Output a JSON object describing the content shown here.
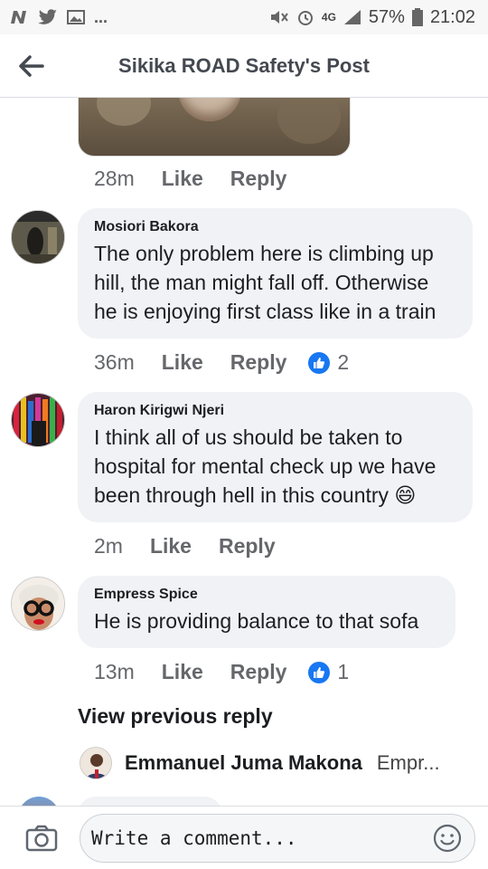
{
  "status_bar": {
    "left_icons": [
      "n-notification-icon",
      "twitter-icon",
      "image-icon"
    ],
    "more": "...",
    "network": "4G",
    "battery": "57%",
    "time": "21:02"
  },
  "header": {
    "title": "Sikika ROAD Safety's Post",
    "back_icon": "arrow-left-icon"
  },
  "comments": [
    {
      "time": "28m",
      "like_label": "Like",
      "reply_label": "Reply"
    },
    {
      "author": "Mosiori Bakora",
      "text": "The only problem here is climbing up hill, the man might fall off. Otherwise he is enjoying first class like in a train",
      "time": "36m",
      "like_label": "Like",
      "reply_label": "Reply",
      "reactions": "2"
    },
    {
      "author": "Haron Kirigwi Njeri",
      "text": "I think all of us should be taken to hospital for mental check up we have been through hell in this country 😄",
      "time": "2m",
      "like_label": "Like",
      "reply_label": "Reply"
    },
    {
      "author": "Empress Spice",
      "text": "He is providing balance to that sofa",
      "time": "13m",
      "like_label": "Like",
      "reply_label": "Reply",
      "reactions": "1"
    }
  ],
  "view_previous": "View previous reply",
  "reply_preview": {
    "author": "Emmanuel Juma Makona",
    "snippet": "Empr..."
  },
  "composer": {
    "placeholder": "Write a comment...",
    "camera_icon": "camera-icon",
    "emoji_icon": "smiley-icon"
  },
  "colors": {
    "accent": "#1877f2",
    "bubble": "#f0f2f5",
    "meta": "#65676b"
  }
}
